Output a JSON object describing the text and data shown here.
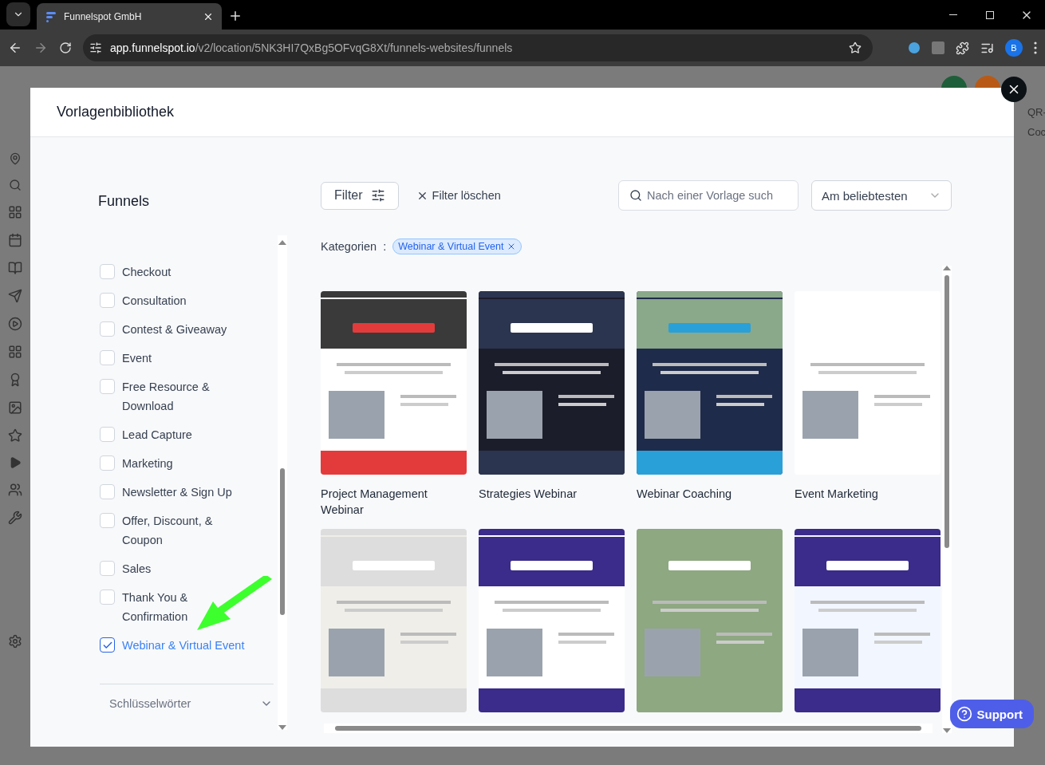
{
  "browser": {
    "tab_title": "Funnelspot GmbH",
    "url_host": "app.funnelspot.io",
    "url_path": "/v2/location/5NK3HI7QxBg5OFvqG8Xt/funnels-websites/funnels",
    "profile": "B"
  },
  "background": {
    "labels": [
      "QR-",
      "Coc"
    ]
  },
  "modal": {
    "title": "Vorlagenbibliothek"
  },
  "sidebar": {
    "heading": "Funnels",
    "keywords_heading": "Schlüsselwörter",
    "categories": [
      {
        "label": "Checkout",
        "checked": false
      },
      {
        "label": "Consultation",
        "checked": false
      },
      {
        "label": "Contest & Giveaway",
        "checked": false
      },
      {
        "label": "Event",
        "checked": false
      },
      {
        "label": "Free Resource & Download",
        "checked": false
      },
      {
        "label": "Lead Capture",
        "checked": false
      },
      {
        "label": "Marketing",
        "checked": false
      },
      {
        "label": "Newsletter & Sign Up",
        "checked": false
      },
      {
        "label": "Offer, Discount, & Coupon",
        "checked": false
      },
      {
        "label": "Sales",
        "checked": false
      },
      {
        "label": "Thank You & Confirmation",
        "checked": false
      },
      {
        "label": "Webinar & Virtual Event",
        "checked": true
      }
    ]
  },
  "toolbar": {
    "filter": "Filter",
    "clear": "Filter löschen",
    "search_placeholder": "Nach einer Vorlage such",
    "sort": "Am beliebtesten"
  },
  "active_filters": {
    "label": "Kategorien",
    "separator": ":",
    "chips": [
      "Webinar & Virtual Event"
    ]
  },
  "templates": [
    {
      "title": "Project Management Webinar"
    },
    {
      "title": "Strategies Webinar"
    },
    {
      "title": "Webinar Coaching"
    },
    {
      "title": "Event Marketing"
    }
  ],
  "support": "Support"
}
